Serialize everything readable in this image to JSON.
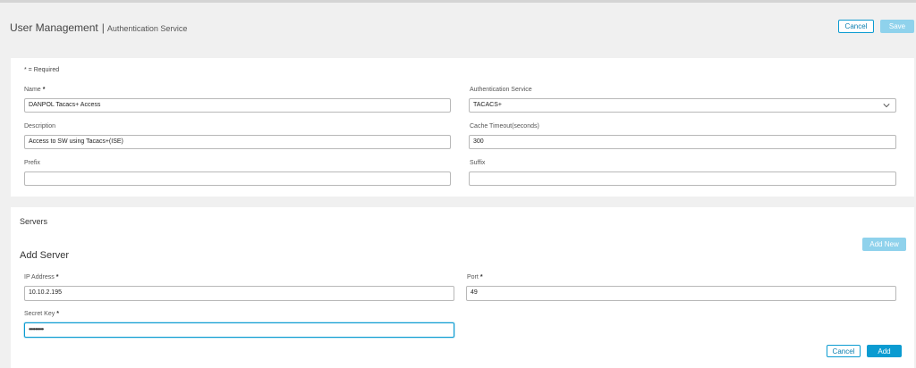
{
  "header": {
    "title": "User Management",
    "separator": "|",
    "subtitle": "Authentication Service",
    "cancel_label": "Cancel",
    "save_label": "Save"
  },
  "form": {
    "required_note": "* = Required",
    "name": {
      "label": "Name",
      "required": "*",
      "value": "DANPOL Tacacs+ Access"
    },
    "auth_service": {
      "label": "Authentication Service",
      "value": "TACACS+"
    },
    "description": {
      "label": "Description",
      "value": "Access to SW using Tacacs+(ISE)"
    },
    "cache_timeout": {
      "label": "Cache Timeout(seconds)",
      "value": "300"
    },
    "prefix": {
      "label": "Prefix",
      "value": ""
    },
    "suffix": {
      "label": "Suffix",
      "value": ""
    }
  },
  "servers": {
    "title": "Servers",
    "add_new_label": "Add New",
    "add_server_title": "Add Server",
    "ip": {
      "label": "IP Address",
      "required": "*",
      "value": "10.10.2.195"
    },
    "port": {
      "label": "Port",
      "required": "*",
      "value": "49"
    },
    "secret": {
      "label": "Secret Key",
      "required": "*",
      "value": "•••••••••"
    },
    "cancel_label": "Cancel",
    "add_label": "Add"
  },
  "colors": {
    "accent": "#0b9bd1",
    "accent_disabled": "#8fd2ec",
    "background": "#f0f0f0",
    "panel": "#ffffff"
  },
  "icons": {
    "select_arrow": "chevron-down-icon"
  }
}
